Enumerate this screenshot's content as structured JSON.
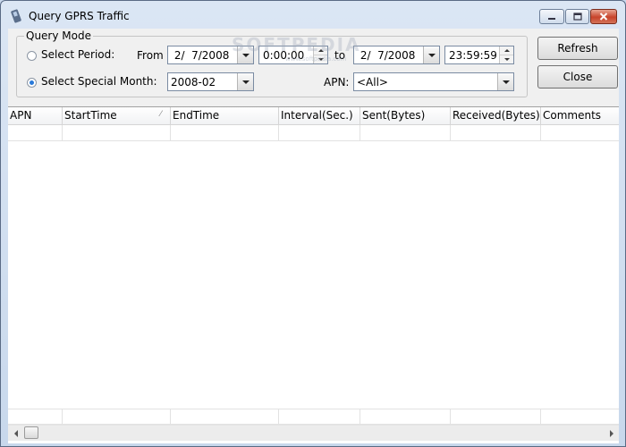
{
  "window": {
    "title": "Query GPRS Traffic"
  },
  "query_mode": {
    "legend": "Query Mode",
    "select_period_label": "Select Period:",
    "select_period_checked": false,
    "select_month_label": "Select Special Month:",
    "select_month_checked": true,
    "from_label": "From",
    "from_date": " 2/  7/2008",
    "from_time": "0:00:00",
    "to_label": "to",
    "to_date": " 2/  7/2008",
    "to_time": "23:59:59",
    "month_value": "2008-02",
    "apn_label": "APN:",
    "apn_value": "<All>"
  },
  "buttons": {
    "refresh": "Refresh",
    "close": "Close"
  },
  "table": {
    "columns": [
      "APN",
      "StartTime",
      "EndTime",
      "Interval(Sec.)",
      "Sent(Bytes)",
      "Received(Bytes)",
      "Comments"
    ]
  },
  "watermark": {
    "text": "SOFTPEDIA",
    "url": "www.softpedia.com"
  },
  "colors": {
    "title_bar": "#dbe6f4",
    "radio_dot": "#2979d9",
    "close_button": "#c7432b"
  }
}
